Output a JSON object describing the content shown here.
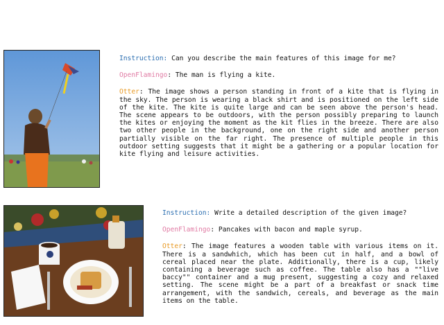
{
  "examples": [
    {
      "instruction_label": "Instruction:",
      "instruction_text": " Can you describe the main features of this image for me?",
      "openflamingo_label": "OpenFlamingo",
      "openflamingo_text": ": The man is flying a kite.",
      "otter_label": "Otter",
      "otter_text": ": The image shows a person standing in front of a kite that is flying in the sky. The person is wearing a black shirt and is positioned on the left side of the kite. The kite is quite large and can be seen above the person's head. The scene appears to be outdoors, with the person possibly preparing to launch the kites or enjoying the moment as the kit flies in the breeze. There are also two other people in the background, one on the right side and another person partially visible on the far right. The presence of multiple people in this outdoor setting suggests that it might be a gathering or a popular location for kite flying and leisure activities."
    },
    {
      "instruction_label": "Instruction:",
      "instruction_text": " Write a detailed description of the given image?",
      "openflamingo_label": "OpenFlamingo",
      "openflamingo_text": ": Pancakes with bacon and maple syrup.",
      "otter_label": "Otter",
      "otter_text": ": The image features a wooden table with various items on it. There is a sandwhich, which has been cut in half, and a bowl of cereal placed near the plate. Additionally, there is a cup, likely containing a beverage such as coffee. The table also has a \"\"live baccy\"\" container and a mug present, suggesting a cozy and relaxed setting. The scene might be a part of a breakfast or snack time arrangement, with the sandwich, cereals, and beverage as the main items on the table."
    }
  ],
  "colors": {
    "instruction": "#2a6db0",
    "openflamingo": "#e07aa3",
    "otter": "#e89a25"
  }
}
